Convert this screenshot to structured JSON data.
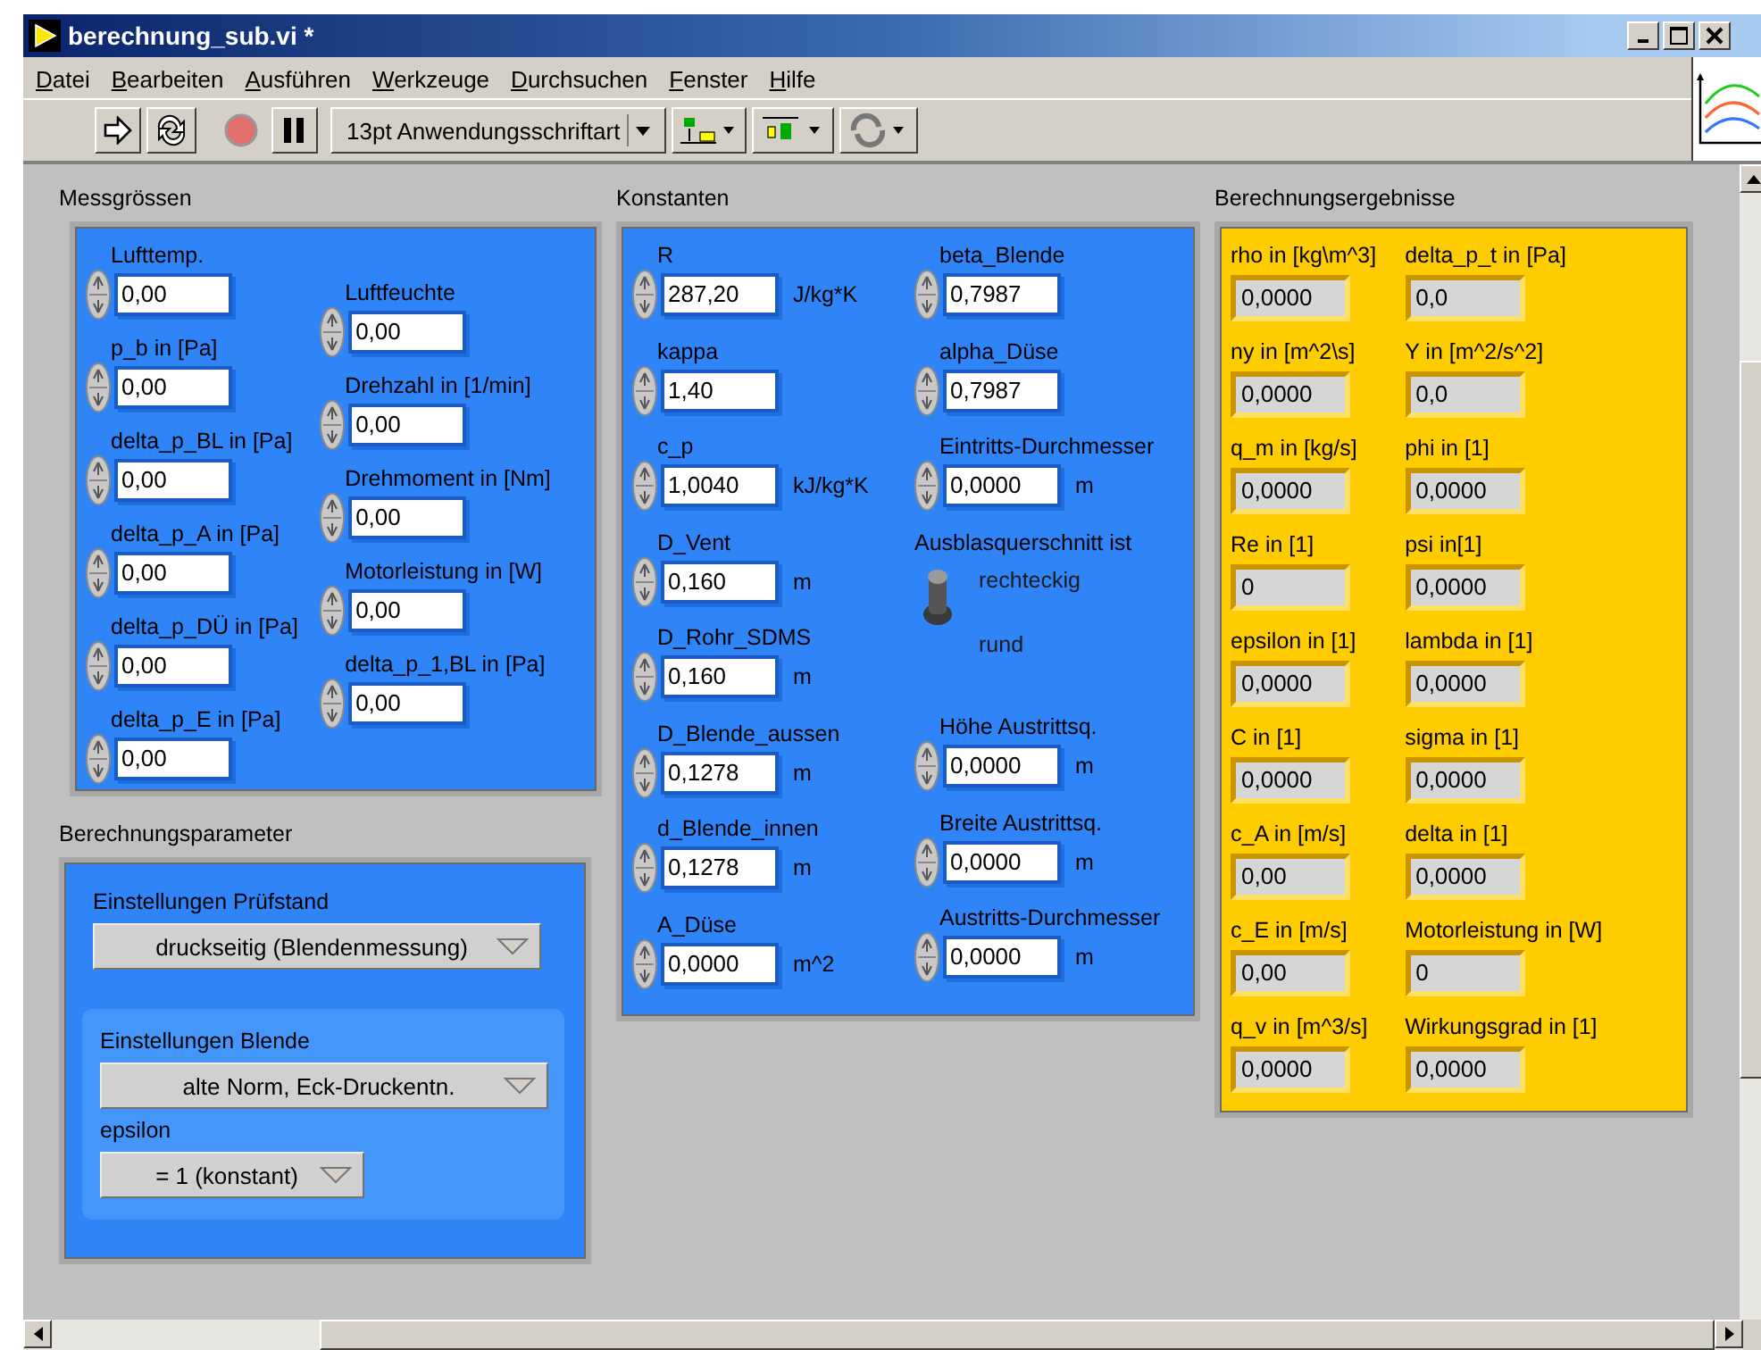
{
  "window": {
    "title": "berechnung_sub.vi *"
  },
  "menu": [
    "Datei",
    "Bearbeiten",
    "Ausführen",
    "Werkzeuge",
    "Durchsuchen",
    "Fenster",
    "Hilfe"
  ],
  "toolbar": {
    "font": "13pt Anwendungsschriftart"
  },
  "measurements": {
    "title": "Messgrössen",
    "columns": [
      [
        {
          "label": "Lufttemp.",
          "value": "0,00"
        },
        {
          "label": "p_b in [Pa]",
          "value": "0,00"
        },
        {
          "label": "delta_p_BL in [Pa]",
          "value": "0,00"
        },
        {
          "label": "delta_p_A in [Pa]",
          "value": "0,00"
        },
        {
          "label": "delta_p_DÜ in [Pa]",
          "value": "0,00"
        },
        {
          "label": "delta_p_E in [Pa]",
          "value": "0,00"
        }
      ],
      [
        {
          "label": "Luftfeuchte",
          "value": "0,00"
        },
        {
          "label": "Drehzahl in [1/min]",
          "value": "0,00"
        },
        {
          "label": "Drehmoment in [Nm]",
          "value": "0,00"
        },
        {
          "label": "Motorleistung in [W]",
          "value": "0,00"
        },
        {
          "label": "delta_p_1,BL in [Pa]",
          "value": "0,00"
        }
      ]
    ]
  },
  "parameters": {
    "title": "Berechnungsparameter",
    "settings": [
      {
        "label": "Einstellungen Prüfstand",
        "value": "druckseitig (Blendenmessung)"
      }
    ],
    "group": {
      "items": [
        {
          "label": "Einstellungen Blende",
          "value": "alte Norm, Eck-Druckentn."
        },
        {
          "label": "epsilon",
          "value": "= 1 (konstant)"
        }
      ]
    }
  },
  "constants": {
    "title": "Konstanten",
    "columns": [
      [
        {
          "kind": "numeric",
          "label": "R",
          "value": "287,20",
          "unit": "J/kg*K"
        },
        {
          "kind": "numeric",
          "label": "kappa",
          "value": "1,40"
        },
        {
          "kind": "numeric",
          "label": "c_p",
          "value": "1,0040",
          "unit": "kJ/kg*K"
        },
        {
          "kind": "numeric",
          "label": "D_Vent",
          "value": "0,160",
          "unit": "m"
        },
        {
          "kind": "numeric",
          "label": "D_Rohr_SDMS",
          "value": "0,160",
          "unit": "m"
        },
        {
          "kind": "numeric",
          "label": "D_Blende_aussen",
          "value": "0,1278",
          "unit": "m"
        },
        {
          "kind": "numeric",
          "label": "d_Blende_innen",
          "value": "0,1278",
          "unit": "m"
        },
        {
          "kind": "numeric",
          "label": "A_Düse",
          "value": "0,0000",
          "unit": "m^2"
        }
      ],
      [
        {
          "kind": "numeric",
          "label": "beta_Blende",
          "value": "0,7987"
        },
        {
          "kind": "numeric",
          "label": "alpha_Düse",
          "value": "0,7987"
        },
        {
          "kind": "numeric",
          "label": "Eintritts-Durchmesser",
          "value": "0,0000",
          "unit": "m"
        },
        {
          "kind": "switch",
          "label": "Ausblasquerschnitt ist",
          "on": true,
          "options": [
            "rechteckig",
            "rund"
          ]
        },
        {
          "kind": "numeric",
          "label": "Höhe Austrittsq.",
          "value": "0,0000",
          "unit": "m"
        },
        {
          "kind": "numeric",
          "label": "Breite Austrittsq.",
          "value": "0,0000",
          "unit": "m"
        },
        {
          "kind": "numeric",
          "label": "Austritts-Durchmesser",
          "value": "0,0000",
          "unit": "m"
        }
      ]
    ]
  },
  "results": {
    "title": "Berechnungsergebnisse",
    "columns": [
      [
        {
          "label": "rho in [kg\\m^3]",
          "value": "0,0000"
        },
        {
          "label": "ny in [m^2\\s]",
          "value": "0,0000"
        },
        {
          "label": "q_m in [kg/s]",
          "value": "0,0000"
        },
        {
          "label": "Re in [1]",
          "value": "0"
        },
        {
          "label": "epsilon in [1]",
          "value": "0,0000"
        },
        {
          "label": "C in [1]",
          "value": "0,0000"
        },
        {
          "label": "c_A in [m/s]",
          "value": "0,00"
        },
        {
          "label": "c_E in [m/s]",
          "value": "0,00"
        },
        {
          "label": "q_v in [m^3/s]",
          "value": "0,0000"
        }
      ],
      [
        {
          "label": "delta_p_t in [Pa]",
          "value": "0,0"
        },
        {
          "label": "Y in [m^2/s^2]",
          "value": "0,0"
        },
        {
          "label": "phi in [1]",
          "value": "0,0000"
        },
        {
          "label": "psi in[1]",
          "value": "0,0000"
        },
        {
          "label": "lambda in [1]",
          "value": "0,0000"
        },
        {
          "label": "sigma in [1]",
          "value": "0,0000"
        },
        {
          "label": "delta in [1]",
          "value": "0,0000"
        },
        {
          "label": "Motorleistung in [W]",
          "value": "0"
        },
        {
          "label": "Wirkungsgrad in [1]",
          "value": "0,0000"
        }
      ]
    ]
  }
}
